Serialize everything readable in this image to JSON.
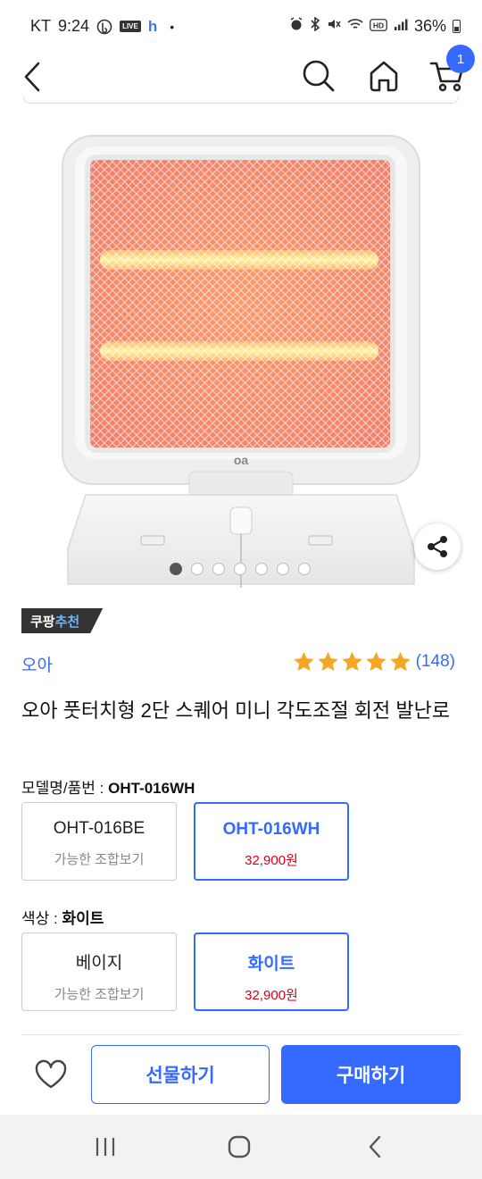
{
  "status_bar": {
    "carrier": "KT",
    "time": "9:24",
    "live_badge": "LIVE",
    "h_icon": "h",
    "dot": "•",
    "battery": "36%"
  },
  "header": {
    "back_icon": "back-arrow-icon",
    "search_icon": "search-icon",
    "home_icon": "home-icon",
    "cart_icon": "cart-icon",
    "cart_count": "1"
  },
  "gallery": {
    "total_images": 7,
    "active_index": 0
  },
  "product": {
    "badge_prefix": "쿠팡",
    "badge_highlight": "추천",
    "brand": "오아",
    "rating_stars": 5,
    "review_count": "(148)",
    "title": "오아 풋터치형 2단 스퀘어 미니 각도조절 회전 발난로"
  },
  "options": {
    "model": {
      "label": "모델명/품번 : ",
      "selected": "OHT-016WH",
      "cards": [
        {
          "name": "OHT-016BE",
          "sub": "가능한 조합보기",
          "selected": false
        },
        {
          "name": "OHT-016WH",
          "sub": "32,900원",
          "selected": true
        }
      ]
    },
    "color": {
      "label": "색상 : ",
      "selected": "화이트",
      "cards": [
        {
          "name": "베이지",
          "sub": "가능한 조합보기",
          "selected": false
        },
        {
          "name": "화이트",
          "sub": "32,900원",
          "selected": true
        }
      ]
    }
  },
  "bottom_bar": {
    "wish_icon": "heart-icon",
    "gift_label": "선물하기",
    "buy_label": "구매하기"
  },
  "colors": {
    "accent": "#346aff",
    "price": "#d0021b",
    "star": "#f5a623"
  }
}
